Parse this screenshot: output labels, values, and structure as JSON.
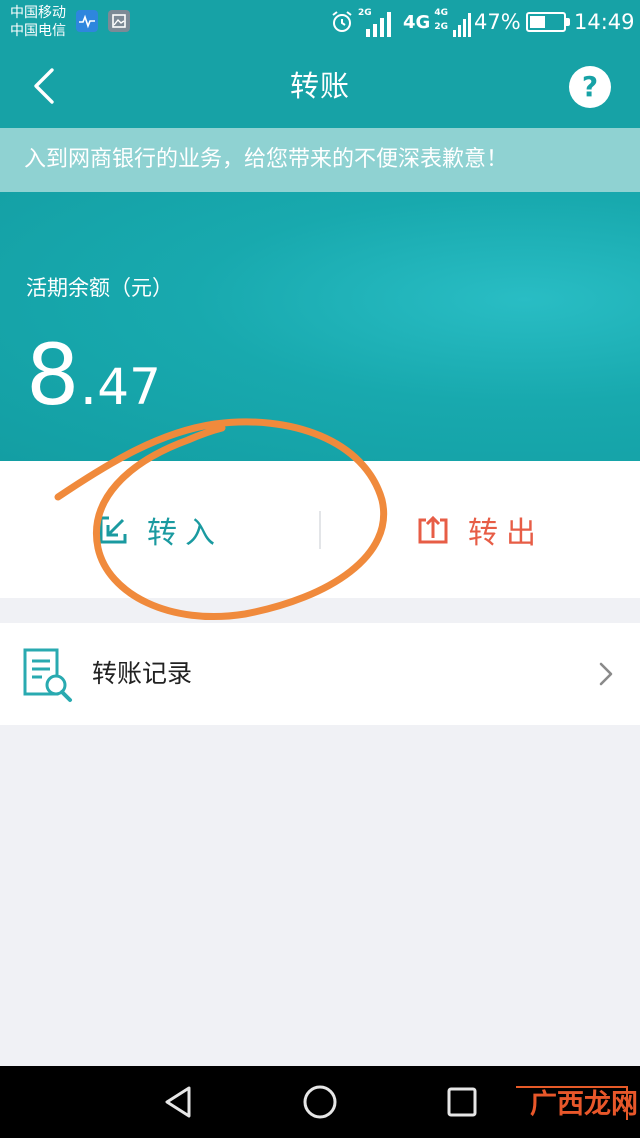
{
  "status_bar": {
    "carrier_1": "中国移动",
    "carrier_2": "中国电信",
    "sim1_network": "2G",
    "sim2_network_big": "4G",
    "sim2_network_top": "4G",
    "sim2_network_bottom": "2G",
    "battery_percent": "47%",
    "battery_level": 0.47,
    "time": "14:49",
    "icons": [
      "health-app-icon",
      "gallery-app-icon",
      "alarm-icon",
      "signal-icon",
      "battery-icon"
    ]
  },
  "header": {
    "title": "转账",
    "back_icon": "chevron-left-icon",
    "help_label": "?"
  },
  "notice": {
    "text": "入到网商银行的业务，给您带来的不便深表歉意！"
  },
  "balance": {
    "label": "活期余额（元）",
    "integer_part": "8",
    "dot": ".",
    "fraction_part": "47"
  },
  "actions": {
    "transfer_in_label": "转入",
    "transfer_out_label": "转出",
    "transfer_in_icon": "transfer-in-icon",
    "transfer_out_icon": "transfer-out-icon"
  },
  "record": {
    "label": "转账记录",
    "icon": "document-search-icon"
  },
  "colors": {
    "primary": "#17a2a6",
    "transfer_in": "#1a9aa0",
    "transfer_out": "#e75d46",
    "annotation": "#f08a3c"
  },
  "watermark": {
    "text": "广西龙网"
  }
}
